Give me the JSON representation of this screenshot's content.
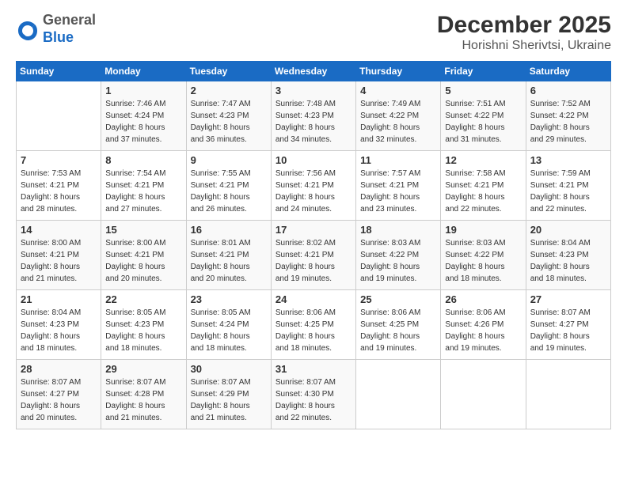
{
  "header": {
    "logo_general": "General",
    "logo_blue": "Blue",
    "title": "December 2025",
    "subtitle": "Horishni Sherivtsi, Ukraine"
  },
  "calendar": {
    "days_of_week": [
      "Sunday",
      "Monday",
      "Tuesday",
      "Wednesday",
      "Thursday",
      "Friday",
      "Saturday"
    ],
    "weeks": [
      [
        {
          "day": "",
          "info": ""
        },
        {
          "day": "1",
          "info": "Sunrise: 7:46 AM\nSunset: 4:24 PM\nDaylight: 8 hours\nand 37 minutes."
        },
        {
          "day": "2",
          "info": "Sunrise: 7:47 AM\nSunset: 4:23 PM\nDaylight: 8 hours\nand 36 minutes."
        },
        {
          "day": "3",
          "info": "Sunrise: 7:48 AM\nSunset: 4:23 PM\nDaylight: 8 hours\nand 34 minutes."
        },
        {
          "day": "4",
          "info": "Sunrise: 7:49 AM\nSunset: 4:22 PM\nDaylight: 8 hours\nand 32 minutes."
        },
        {
          "day": "5",
          "info": "Sunrise: 7:51 AM\nSunset: 4:22 PM\nDaylight: 8 hours\nand 31 minutes."
        },
        {
          "day": "6",
          "info": "Sunrise: 7:52 AM\nSunset: 4:22 PM\nDaylight: 8 hours\nand 29 minutes."
        }
      ],
      [
        {
          "day": "7",
          "info": "Sunrise: 7:53 AM\nSunset: 4:21 PM\nDaylight: 8 hours\nand 28 minutes."
        },
        {
          "day": "8",
          "info": "Sunrise: 7:54 AM\nSunset: 4:21 PM\nDaylight: 8 hours\nand 27 minutes."
        },
        {
          "day": "9",
          "info": "Sunrise: 7:55 AM\nSunset: 4:21 PM\nDaylight: 8 hours\nand 26 minutes."
        },
        {
          "day": "10",
          "info": "Sunrise: 7:56 AM\nSunset: 4:21 PM\nDaylight: 8 hours\nand 24 minutes."
        },
        {
          "day": "11",
          "info": "Sunrise: 7:57 AM\nSunset: 4:21 PM\nDaylight: 8 hours\nand 23 minutes."
        },
        {
          "day": "12",
          "info": "Sunrise: 7:58 AM\nSunset: 4:21 PM\nDaylight: 8 hours\nand 22 minutes."
        },
        {
          "day": "13",
          "info": "Sunrise: 7:59 AM\nSunset: 4:21 PM\nDaylight: 8 hours\nand 22 minutes."
        }
      ],
      [
        {
          "day": "14",
          "info": "Sunrise: 8:00 AM\nSunset: 4:21 PM\nDaylight: 8 hours\nand 21 minutes."
        },
        {
          "day": "15",
          "info": "Sunrise: 8:00 AM\nSunset: 4:21 PM\nDaylight: 8 hours\nand 20 minutes."
        },
        {
          "day": "16",
          "info": "Sunrise: 8:01 AM\nSunset: 4:21 PM\nDaylight: 8 hours\nand 20 minutes."
        },
        {
          "day": "17",
          "info": "Sunrise: 8:02 AM\nSunset: 4:21 PM\nDaylight: 8 hours\nand 19 minutes."
        },
        {
          "day": "18",
          "info": "Sunrise: 8:03 AM\nSunset: 4:22 PM\nDaylight: 8 hours\nand 19 minutes."
        },
        {
          "day": "19",
          "info": "Sunrise: 8:03 AM\nSunset: 4:22 PM\nDaylight: 8 hours\nand 18 minutes."
        },
        {
          "day": "20",
          "info": "Sunrise: 8:04 AM\nSunset: 4:23 PM\nDaylight: 8 hours\nand 18 minutes."
        }
      ],
      [
        {
          "day": "21",
          "info": "Sunrise: 8:04 AM\nSunset: 4:23 PM\nDaylight: 8 hours\nand 18 minutes."
        },
        {
          "day": "22",
          "info": "Sunrise: 8:05 AM\nSunset: 4:23 PM\nDaylight: 8 hours\nand 18 minutes."
        },
        {
          "day": "23",
          "info": "Sunrise: 8:05 AM\nSunset: 4:24 PM\nDaylight: 8 hours\nand 18 minutes."
        },
        {
          "day": "24",
          "info": "Sunrise: 8:06 AM\nSunset: 4:25 PM\nDaylight: 8 hours\nand 18 minutes."
        },
        {
          "day": "25",
          "info": "Sunrise: 8:06 AM\nSunset: 4:25 PM\nDaylight: 8 hours\nand 19 minutes."
        },
        {
          "day": "26",
          "info": "Sunrise: 8:06 AM\nSunset: 4:26 PM\nDaylight: 8 hours\nand 19 minutes."
        },
        {
          "day": "27",
          "info": "Sunrise: 8:07 AM\nSunset: 4:27 PM\nDaylight: 8 hours\nand 19 minutes."
        }
      ],
      [
        {
          "day": "28",
          "info": "Sunrise: 8:07 AM\nSunset: 4:27 PM\nDaylight: 8 hours\nand 20 minutes."
        },
        {
          "day": "29",
          "info": "Sunrise: 8:07 AM\nSunset: 4:28 PM\nDaylight: 8 hours\nand 21 minutes."
        },
        {
          "day": "30",
          "info": "Sunrise: 8:07 AM\nSunset: 4:29 PM\nDaylight: 8 hours\nand 21 minutes."
        },
        {
          "day": "31",
          "info": "Sunrise: 8:07 AM\nSunset: 4:30 PM\nDaylight: 8 hours\nand 22 minutes."
        },
        {
          "day": "",
          "info": ""
        },
        {
          "day": "",
          "info": ""
        },
        {
          "day": "",
          "info": ""
        }
      ]
    ]
  }
}
